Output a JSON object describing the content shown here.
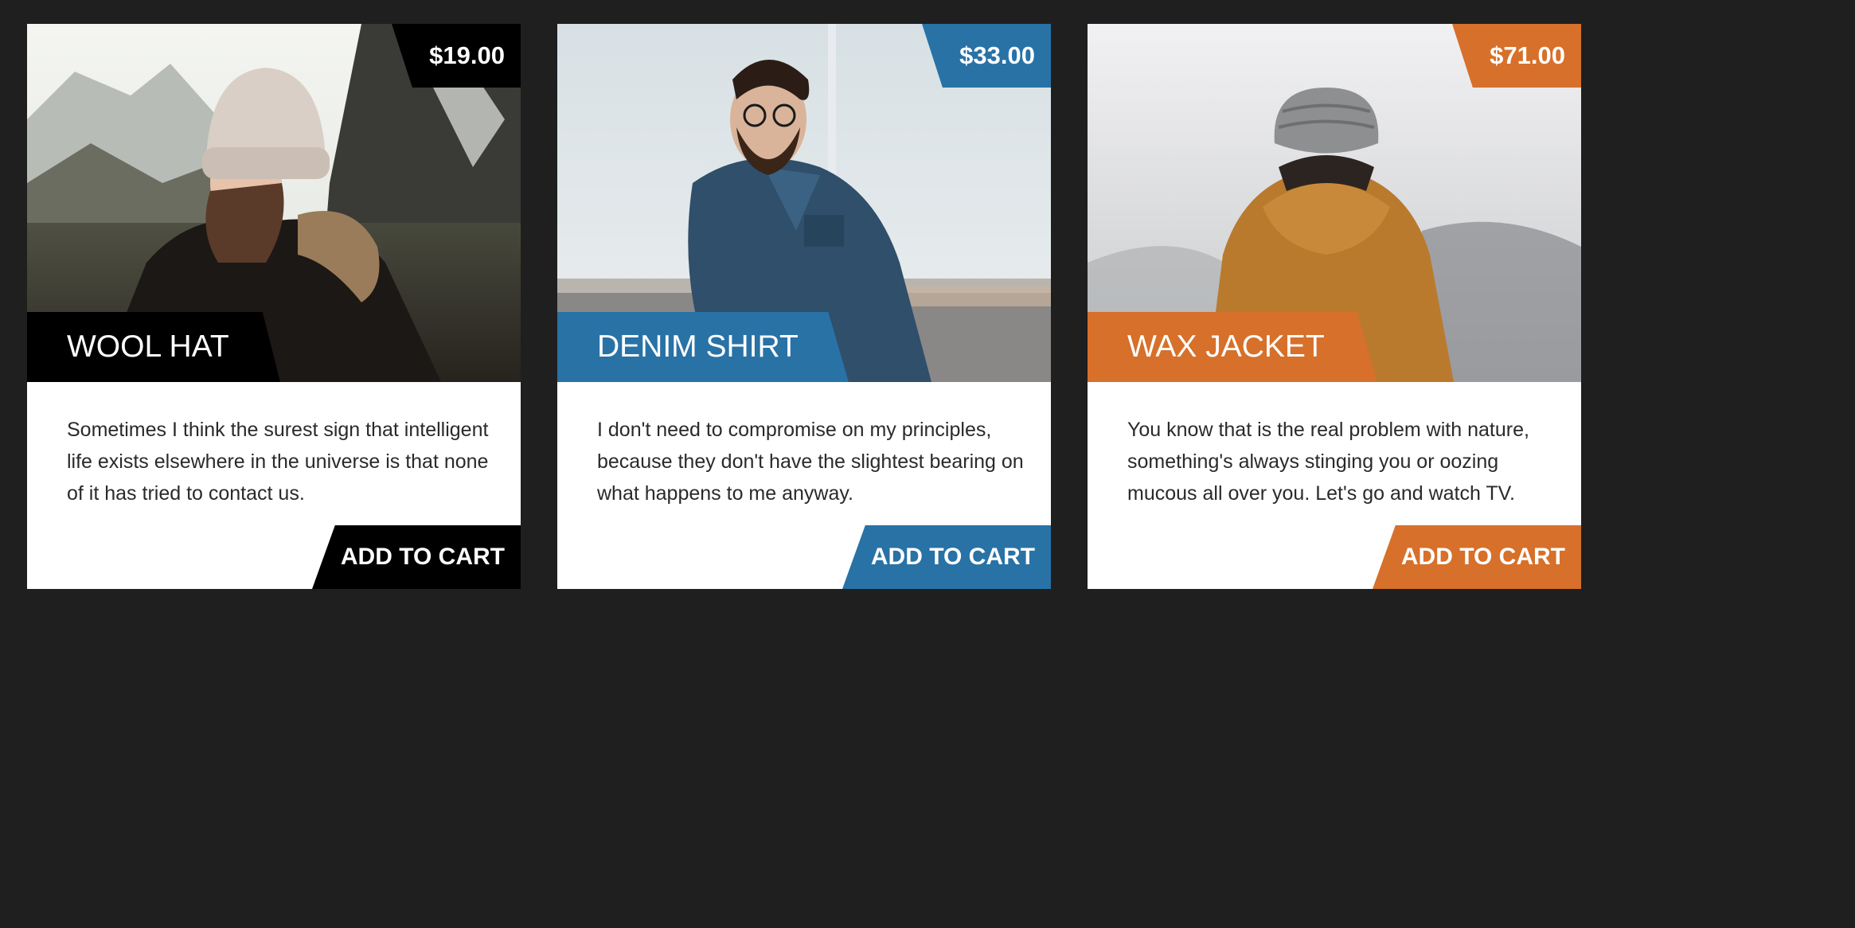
{
  "colors": {
    "page_background": "#1f1f1f",
    "card_background": "#ffffff",
    "accent_black": "#000000",
    "accent_blue": "#2872a6",
    "accent_orange": "#d7702a"
  },
  "products": [
    {
      "name": "WOOL HAT",
      "price": "$19.00",
      "description": "Sometimes I think the surest sign that intelligent life exists elsewhere in the universe is that none of it has tried to contact us.",
      "cta": "ADD TO CART",
      "accent": "#000000",
      "image": "woman-in-wool-hat-mountains-photo"
    },
    {
      "name": "DENIM SHIRT",
      "price": "$33.00",
      "description": "I don't need to compromise on my principles, because they don't have the slightest bearing on what happens to me anyway.",
      "cta": "ADD TO CART",
      "accent": "#2872a6",
      "image": "bearded-man-in-denim-shirt-photo"
    },
    {
      "name": "WAX JACKET",
      "price": "$71.00",
      "description": "You know that is the real problem with nature, something's always stinging you or oozing mucous all over you. Let's go and watch TV.",
      "cta": "ADD TO CART",
      "accent": "#d7702a",
      "image": "person-in-wax-jacket-back-view-photo"
    }
  ]
}
